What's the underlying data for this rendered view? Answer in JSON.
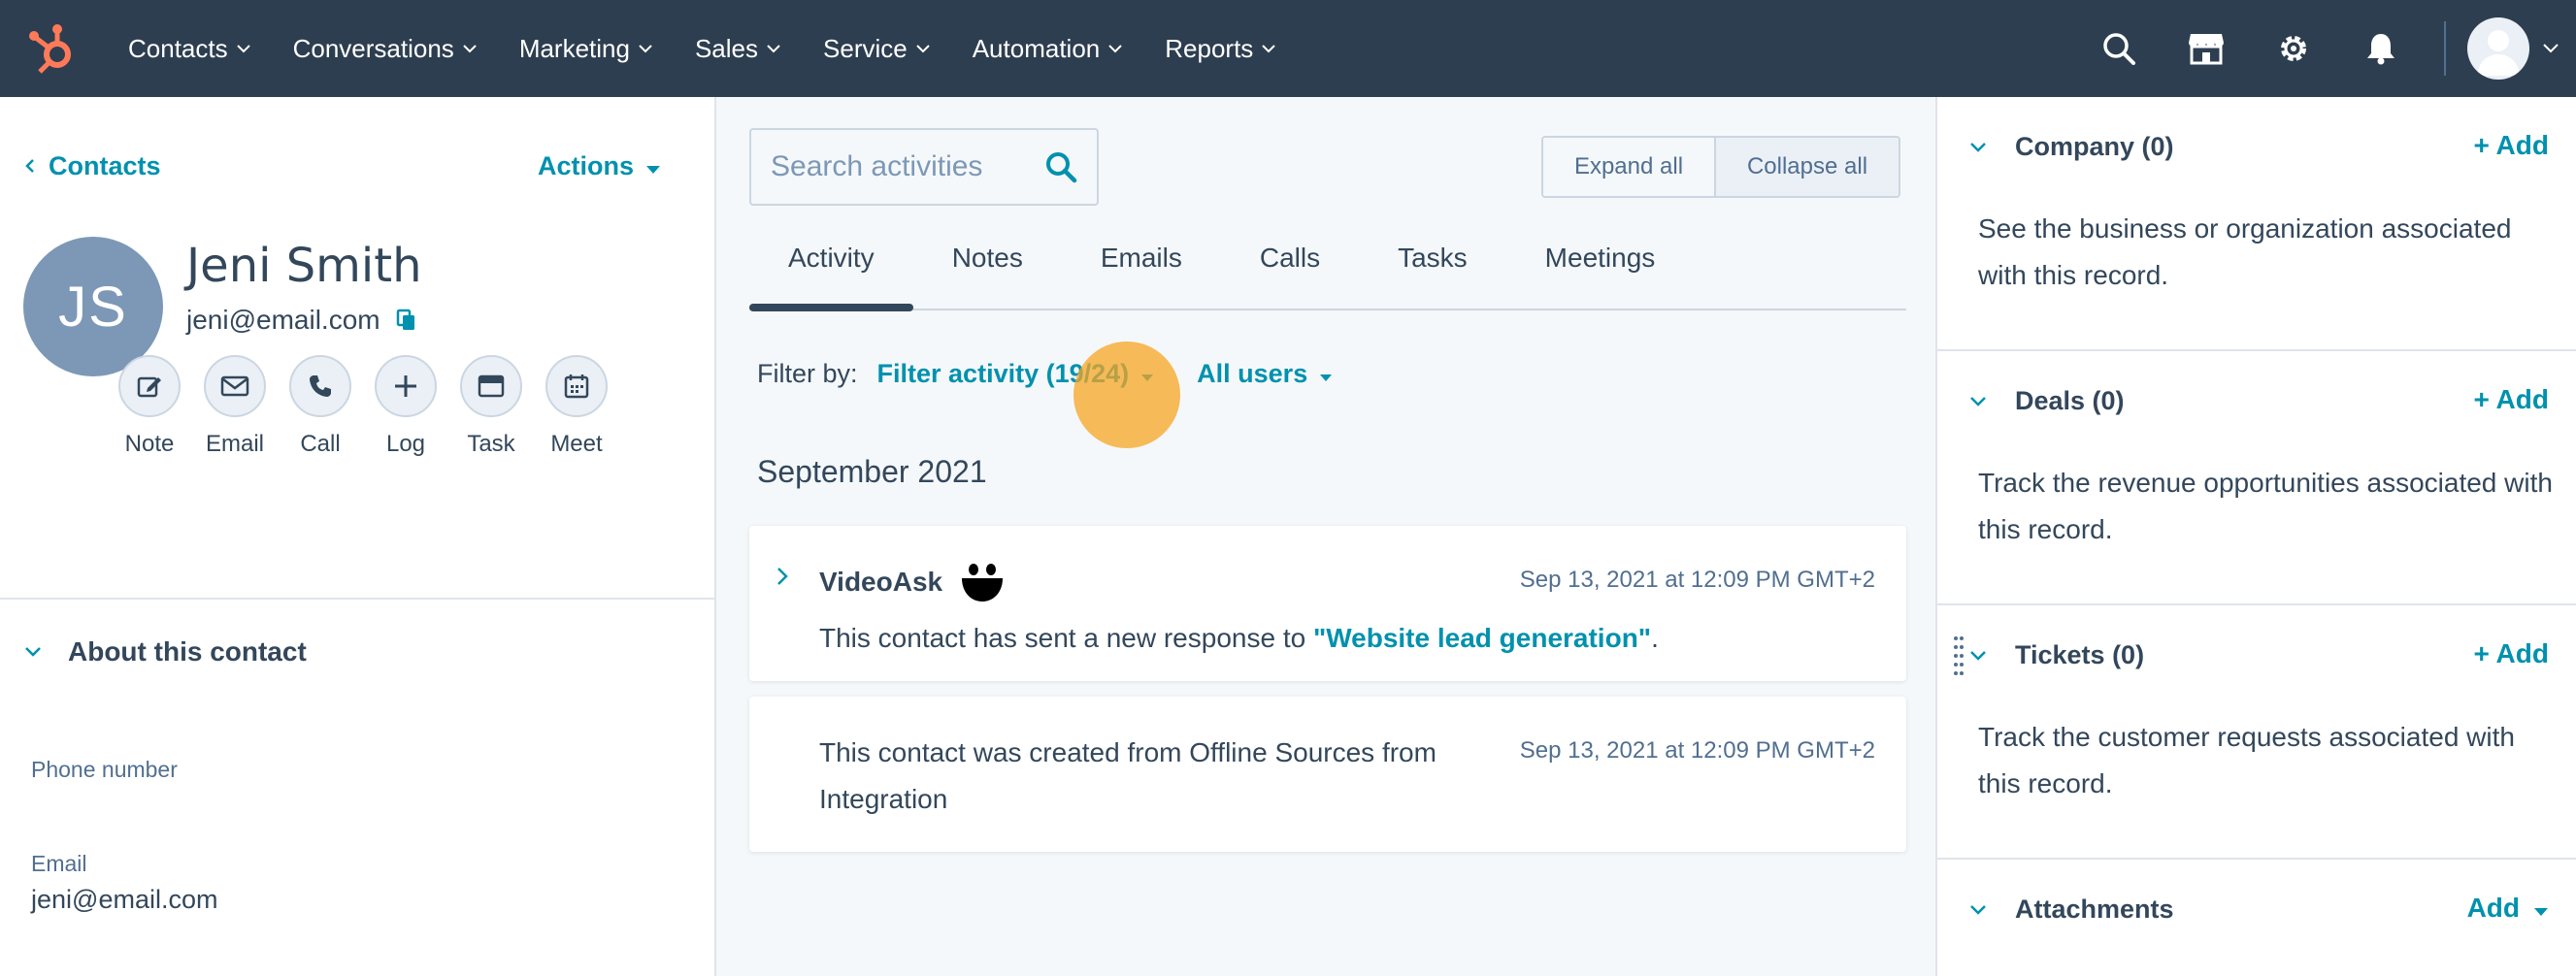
{
  "nav": {
    "items": [
      {
        "label": "Contacts"
      },
      {
        "label": "Conversations"
      },
      {
        "label": "Marketing"
      },
      {
        "label": "Sales"
      },
      {
        "label": "Service"
      },
      {
        "label": "Automation"
      },
      {
        "label": "Reports"
      }
    ],
    "icons": [
      "search-icon",
      "marketplace-icon",
      "settings-gear-icon",
      "notifications-bell-icon"
    ],
    "colors": {
      "bar": "#2d3e50",
      "logo": "#ff7a59"
    }
  },
  "left": {
    "back_label": "Contacts",
    "actions_label": "Actions",
    "contact": {
      "initials": "JS",
      "name": "Jeni Smith",
      "email": "jeni@email.com"
    },
    "quick_actions": [
      {
        "label": "Note",
        "icon": "note-edit-icon"
      },
      {
        "label": "Email",
        "icon": "email-icon"
      },
      {
        "label": "Call",
        "icon": "phone-icon"
      },
      {
        "label": "Log",
        "icon": "plus-icon"
      },
      {
        "label": "Task",
        "icon": "task-icon"
      },
      {
        "label": "Meet",
        "icon": "calendar-icon"
      }
    ],
    "about_title": "About this contact",
    "properties": {
      "phone_label": "Phone number",
      "email_label": "Email",
      "email_value": "jeni@email.com"
    }
  },
  "middle": {
    "search_placeholder": "Search activities",
    "expand_all": "Expand all",
    "collapse_all": "Collapse all",
    "tabs": [
      {
        "label": "Activity",
        "active": true
      },
      {
        "label": "Notes"
      },
      {
        "label": "Emails"
      },
      {
        "label": "Calls"
      },
      {
        "label": "Tasks"
      },
      {
        "label": "Meetings"
      }
    ],
    "filter": {
      "label": "Filter by:",
      "activity": "Filter activity (19/24)",
      "users": "All users"
    },
    "month": "September 2021",
    "cards": [
      {
        "title": "VideoAsk",
        "date": "Sep 13, 2021 at 12:09 PM GMT+2",
        "body_prefix": "This contact has sent a new response to ",
        "body_link": "\"Website lead generation\"",
        "body_suffix": "."
      },
      {
        "body": "This contact was created from Offline Sources from Integration",
        "date": "Sep 13, 2021 at 12:09 PM GMT+2"
      }
    ],
    "accent": "#0091ae"
  },
  "right": {
    "sections": [
      {
        "title": "Company (0)",
        "add": "+ Add",
        "desc": "See the business or organization associated with this record."
      },
      {
        "title": "Deals (0)",
        "add": "+ Add",
        "desc": "Track the revenue opportunities associated with this record."
      },
      {
        "title": "Tickets (0)",
        "add": "+ Add",
        "desc": "Track the customer requests associated with this record."
      },
      {
        "title": "Attachments",
        "add": "Add"
      }
    ]
  }
}
